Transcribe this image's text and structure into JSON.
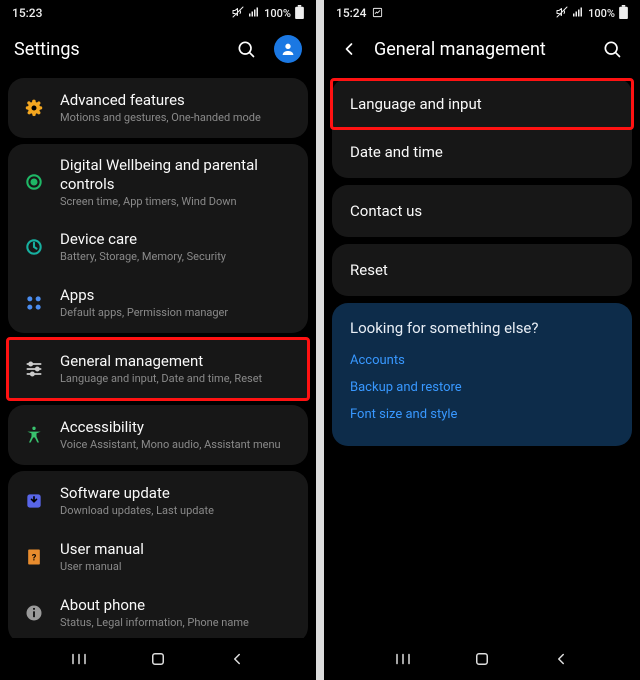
{
  "left": {
    "status": {
      "time": "15:23",
      "battery": "100%"
    },
    "header": {
      "title": "Settings"
    },
    "groups": [
      {
        "items": [
          {
            "icon": "advanced",
            "title": "Advanced features",
            "sub": "Motions and gestures, One-handed mode"
          }
        ]
      },
      {
        "items": [
          {
            "icon": "wellbeing",
            "title": "Digital Wellbeing and parental controls",
            "sub": "Screen time, App timers, Wind Down"
          },
          {
            "icon": "devicecare",
            "title": "Device care",
            "sub": "Battery, Storage, Memory, Security"
          },
          {
            "icon": "apps",
            "title": "Apps",
            "sub": "Default apps, Permission manager"
          }
        ]
      },
      {
        "highlight": true,
        "items": [
          {
            "icon": "general",
            "title": "General management",
            "sub": "Language and input, Date and time, Reset"
          }
        ]
      },
      {
        "items": [
          {
            "icon": "accessibility",
            "title": "Accessibility",
            "sub": "Voice Assistant, Mono audio, Assistant menu"
          }
        ]
      },
      {
        "items": [
          {
            "icon": "update",
            "title": "Software update",
            "sub": "Download updates, Last update"
          },
          {
            "icon": "manual",
            "title": "User manual",
            "sub": "User manual"
          },
          {
            "icon": "about",
            "title": "About phone",
            "sub": "Status, Legal information, Phone name"
          }
        ]
      }
    ]
  },
  "right": {
    "status": {
      "time": "15:24",
      "battery": "100%"
    },
    "header": {
      "title": "General management"
    },
    "group1": [
      {
        "label": "Language and input",
        "highlight": true
      },
      {
        "label": "Date and time"
      }
    ],
    "group2": [
      {
        "label": "Contact us"
      }
    ],
    "group3": [
      {
        "label": "Reset"
      }
    ],
    "tips": {
      "title": "Looking for something else?",
      "links": [
        "Accounts",
        "Backup and restore",
        "Font size and style"
      ]
    }
  }
}
